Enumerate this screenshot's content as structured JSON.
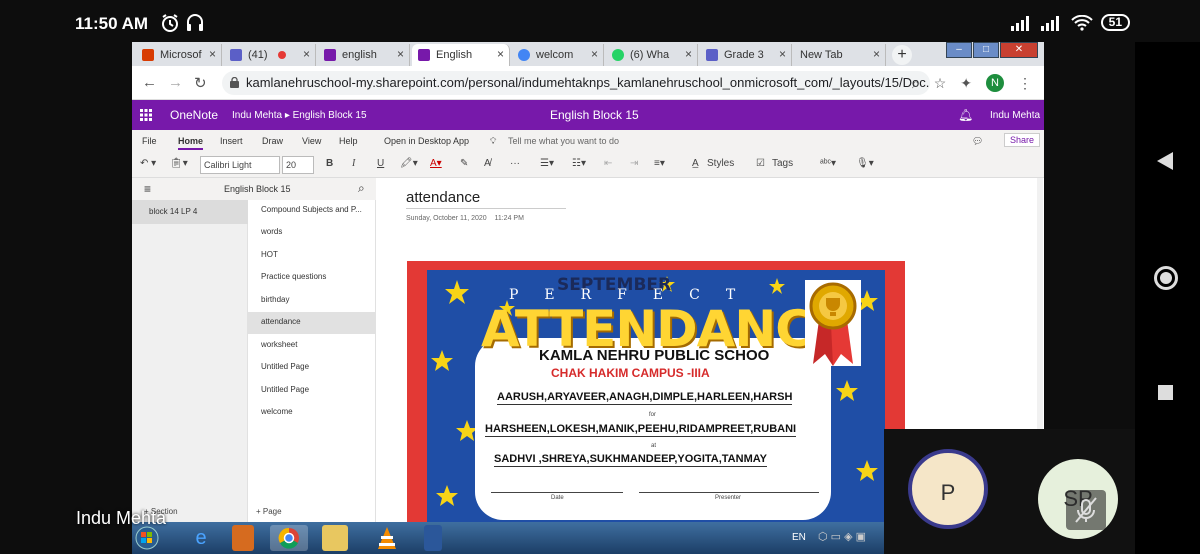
{
  "status_bar": {
    "time": "11:50 AM",
    "battery": "51"
  },
  "browser": {
    "tabs": [
      {
        "label": "Microsof",
        "fav_color": "#d83b01",
        "active": false
      },
      {
        "label": "(41)",
        "fav_color": "#5b5fc7",
        "active": false
      },
      {
        "label": "english",
        "fav_color": "#7719aa",
        "active": false
      },
      {
        "label": "English",
        "fav_color": "#7719aa",
        "active": true
      },
      {
        "label": "welcom",
        "fav_color": "#4285f4",
        "active": false
      },
      {
        "label": "(6) Wha",
        "fav_color": "#25d366",
        "active": false
      },
      {
        "label": "Grade 3",
        "fav_color": "#5b5fc7",
        "active": false
      },
      {
        "label": "New Tab",
        "fav_color": "",
        "active": false
      }
    ],
    "url": "kamlanehruschool-my.sharepoint.com/personal/indumehtaknps_kamlanehruschool_onmicrosoft_com/_layouts/15/Doc.asp...",
    "profile_initial": "N"
  },
  "onenote": {
    "app_name": "OneNote",
    "breadcrumb": "Indu Mehta  ▸  English Block 15",
    "doc_title": "English Block 15",
    "user": "Indu Mehta",
    "ribbon_tabs": [
      "File",
      "Home",
      "Insert",
      "Draw",
      "View",
      "Help",
      "Open in Desktop App"
    ],
    "tell_me": "Tell me what you want to do",
    "share": "Share",
    "font": "Calibri Light",
    "font_size": "20",
    "styles_label": "Styles",
    "tags_label": "Tags",
    "notebook_name": "English Block 15",
    "sections": [
      "block 14 LP 4"
    ],
    "pages": [
      "Compound Subjects and P...",
      "words",
      "HOT",
      "Practice questions",
      "birthday",
      "attendance",
      "worksheet",
      "Untitled Page",
      "Untitled Page",
      "welcome"
    ],
    "selected_page": "attendance",
    "add_section": "+ Section",
    "add_page": "+ Page",
    "page": {
      "title": "attendance",
      "date": "Sunday, October 11, 2020",
      "time": "11:24 PM"
    }
  },
  "certificate": {
    "month": "SEPTEMBER",
    "perfect": "PERFECT",
    "heading": "ATTENDANC",
    "school": "KAMLA NEHRU PUBLIC SCHOO",
    "campus": "CHAK HAKIM CAMPUS -IIIA",
    "names_line1": "AARUSH,ARYAVEER,ANAGH,DIMPLE,HARLEEN,HARSH",
    "for_label": "for",
    "names_line2": "HARSHEEN,LOKESH,MANIK,PEEHU,RIDAMPREET,RUBANI",
    "at_label": "at",
    "names_line3": "SADHVI ,SHREYA,SUKHMANDEEP,YOGITA,TANMAY",
    "date_label": "Date",
    "presenter_label": "Presenter"
  },
  "meeting": {
    "presenter_name": "Indu Mehta",
    "participants": [
      {
        "initials": "P",
        "color": "#f5e6c8"
      },
      {
        "initials": "SP",
        "color": "#e6f0dc"
      }
    ]
  },
  "taskbar": {
    "lang": "EN"
  }
}
